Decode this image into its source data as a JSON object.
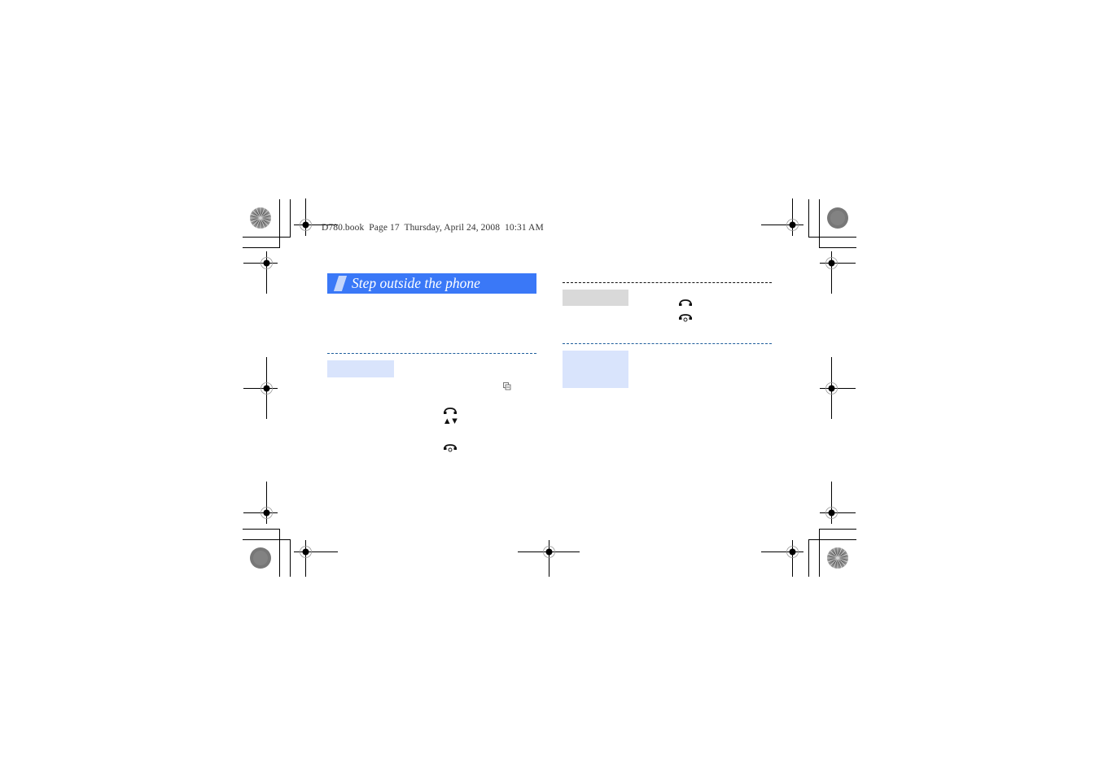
{
  "header": {
    "book_info": "D780.book  Page 17  Thursday, April 24, 2008  10:31 AM"
  },
  "section": {
    "title": "Step outside the phone"
  },
  "icons": {
    "menu_key": "menu-key-icon",
    "call_key": "call-key-icon",
    "nav_up_down": "navigation-up-down-icon",
    "end_key": "end-key-icon"
  },
  "glyphs": {
    "up_down": "▲ ▼"
  },
  "colors": {
    "banner_blue": "#3a78f7",
    "banner_accent": "#c5d6fb",
    "label_blue": "#d9e4fc",
    "label_gray": "#d9d9d9",
    "divider_blue": "#1f5e9c"
  }
}
